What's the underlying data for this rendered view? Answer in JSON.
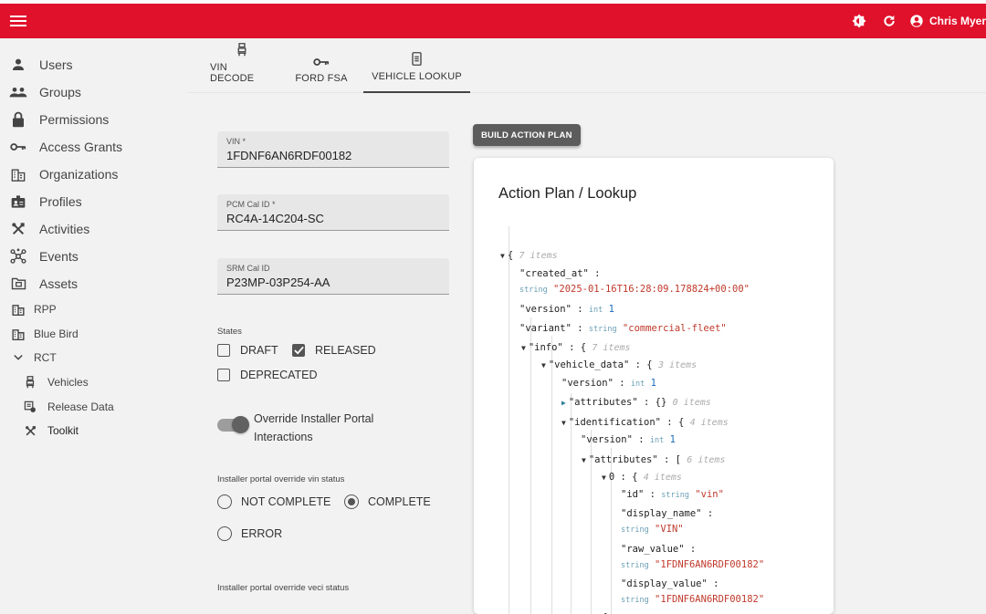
{
  "header": {
    "user_name": "Chris Myer"
  },
  "sidebar": {
    "items": [
      {
        "label": "Users",
        "icon": "person-icon"
      },
      {
        "label": "Groups",
        "icon": "group-icon"
      },
      {
        "label": "Permissions",
        "icon": "lock-icon"
      },
      {
        "label": "Access Grants",
        "icon": "key-icon"
      },
      {
        "label": "Organizations",
        "icon": "building-icon"
      },
      {
        "label": "Profiles",
        "icon": "badge-icon"
      },
      {
        "label": "Activities",
        "icon": "tools-icon"
      },
      {
        "label": "Events",
        "icon": "hub-icon"
      },
      {
        "label": "Assets",
        "icon": "folder-icon"
      },
      {
        "label": "RPP",
        "icon": "building-icon"
      },
      {
        "label": "Blue Bird",
        "icon": "building-icon"
      },
      {
        "label": "RCT",
        "icon": "chevron-down-icon"
      },
      {
        "label": "Vehicles",
        "icon": "car-seat-icon"
      },
      {
        "label": "Release Data",
        "icon": "data-icon"
      },
      {
        "label": "Toolkit",
        "icon": "tools-icon"
      }
    ]
  },
  "tabs": [
    {
      "label": "VIN DECODE"
    },
    {
      "label": "FORD FSA"
    },
    {
      "label": "VEHICLE LOOKUP",
      "active": true
    }
  ],
  "form": {
    "vin": {
      "label": "VIN *",
      "value": "1FDNF6AN6RDF00182"
    },
    "pcm": {
      "label": "PCM Cal ID *",
      "value": "RC4A-14C204-SC"
    },
    "srm": {
      "label": "SRM Cal ID",
      "value": "P23MP-03P254-AA"
    },
    "states_label": "States",
    "states": [
      {
        "label": "DRAFT",
        "checked": false
      },
      {
        "label": "RELEASED",
        "checked": true
      },
      {
        "label": "DEPRECATED",
        "checked": false
      }
    ],
    "override_label": "Override Installer Portal Interactions",
    "vin_status_label": "Installer portal override vin status",
    "vin_status": [
      {
        "label": "NOT COMPLETE",
        "selected": false
      },
      {
        "label": "COMPLETE",
        "selected": true
      },
      {
        "label": "ERROR",
        "selected": false
      }
    ],
    "veci_status_label": "Installer portal override veci status"
  },
  "build_button": "BUILD ACTION PLAN",
  "card": {
    "title": "Action Plan / Lookup",
    "json": {
      "root_open": "{",
      "root_count": "7 items",
      "created_at_key": "\"created_at\"",
      "created_at_type": "string",
      "created_at_val": "\"2025-01-16T16:28:09.178824+00:00\"",
      "version_key": "\"version\"",
      "version_type": "int",
      "version_val": "1",
      "variant_key": "\"variant\"",
      "variant_type": "string",
      "variant_val": "\"commercial-fleet\"",
      "info_key": "\"info\"",
      "info_count": "7 items",
      "vehicle_data_key": "\"vehicle_data\"",
      "vehicle_data_count": "3 items",
      "vd_version_key": "\"version\"",
      "vd_version_type": "int",
      "vd_version_val": "1",
      "attributes_key": "\"attributes\"",
      "attributes_val": "{}",
      "attributes_count": "0 items",
      "identification_key": "\"identification\"",
      "identification_count": "4 items",
      "id_version_key": "\"version\"",
      "id_version_type": "int",
      "id_version_val": "1",
      "id_attributes_key": "\"attributes\"",
      "id_attributes_count": "6 items",
      "item0_key": "0",
      "item0_count": "4 items",
      "id_key": "\"id\"",
      "id_type": "string",
      "id_val": "\"vin\"",
      "display_name_key": "\"display_name\"",
      "display_name_type": "string",
      "display_name_val": "\"VIN\"",
      "raw_value_key": "\"raw_value\"",
      "raw_value_type": "string",
      "raw_value_val": "\"1FDNF6AN6RDF00182\"",
      "display_value_key": "\"display_value\"",
      "display_value_type": "string",
      "display_value_val": "\"1FDNF6AN6RDF00182\"",
      "close_brace": "}"
    }
  }
}
